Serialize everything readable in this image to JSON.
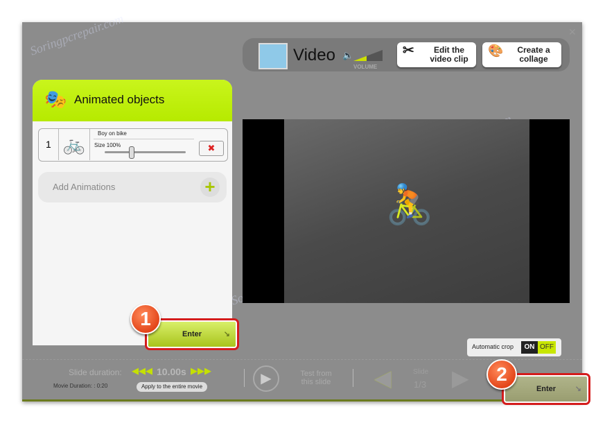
{
  "watermark": "Soringpcrepair.com",
  "topbar": {
    "title": "Video",
    "volume_label": "VOLUME",
    "edit_button": "Edit the video clip",
    "collage_button": "Create a collage"
  },
  "panel": {
    "title": "Animated objects",
    "objects": [
      {
        "index": "1",
        "name": "Boy on bike",
        "size_label": "Size 100%",
        "size_value": 100
      }
    ],
    "add_label": "Add Animations",
    "enter_label": "Enter"
  },
  "crop": {
    "label": "Automatic crop",
    "on": "ON",
    "off": "OFF"
  },
  "bottom": {
    "slide_duration_label": "Slide duration:",
    "duration": "10.00s",
    "movie_duration": "Movie Duration: : 0:20",
    "apply_button": "Apply to the entire movie",
    "test_label": "Test from this slide",
    "slide_label": "Slide",
    "slide_count": "1/3",
    "enter_label": "Enter"
  },
  "badges": [
    "1",
    "2"
  ],
  "colors": {
    "accent": "#b6ea00",
    "highlight": "#d41c1c"
  }
}
